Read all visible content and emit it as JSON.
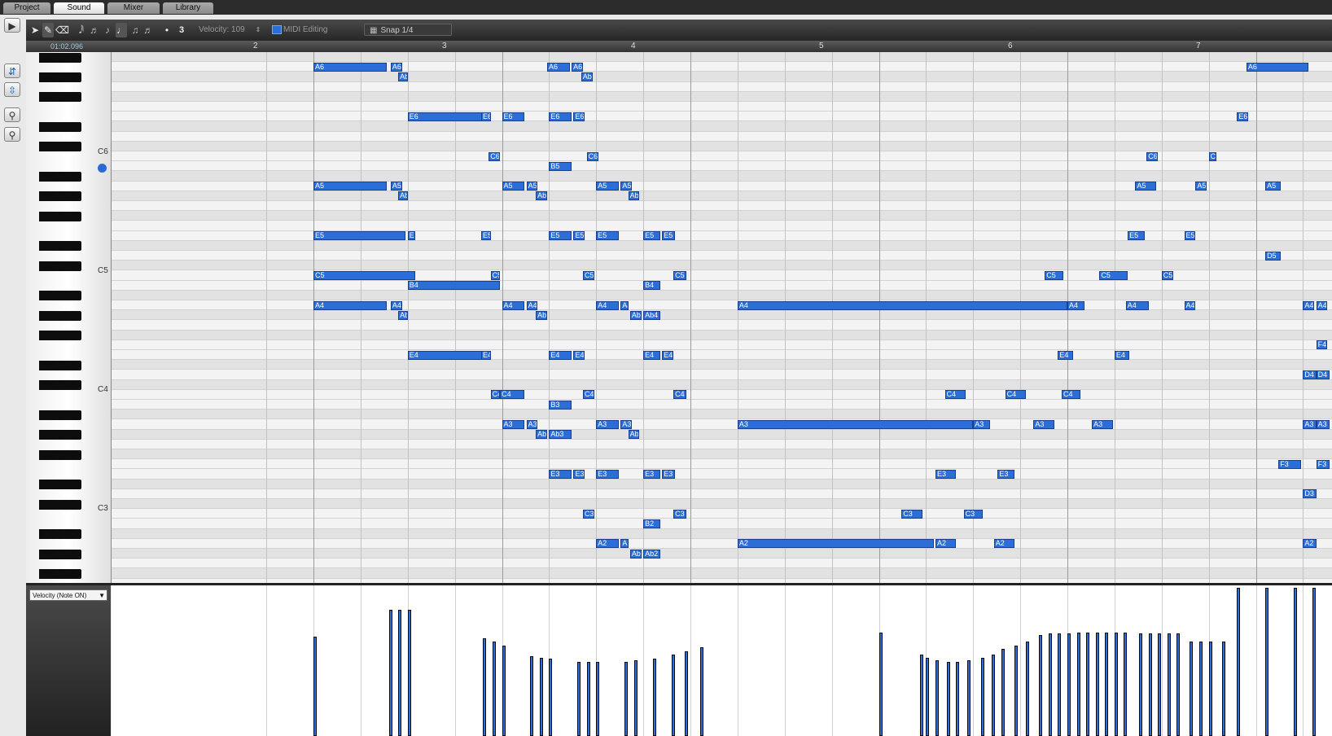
{
  "tabs": [
    {
      "label": "Project",
      "active": false
    },
    {
      "label": "Sound",
      "active": true
    },
    {
      "label": "Mixer",
      "active": false
    },
    {
      "label": "Library",
      "active": false
    }
  ],
  "toolbar": {
    "tools": [
      "pointer-tool-icon",
      "pencil-tool-icon",
      "eraser-tool-icon",
      "note-32nd-icon",
      "note-16th-icon",
      "note-8th-icon",
      "note-quarter-icon",
      "note-half-icon",
      "note-whole-icon",
      "dot-icon"
    ],
    "triplet_value": "3",
    "velocity_label": "Velocity: 109",
    "midi_editing_label": "MIDI Editing",
    "snap_label": "Snap 1/4"
  },
  "ruler": {
    "position": "01:02.096",
    "bars": [
      "2",
      "3",
      "4",
      "5",
      "6",
      "7"
    ]
  },
  "keyboard": {
    "c_labels": [
      "C6",
      "C5",
      "C4",
      "C3"
    ]
  },
  "accent_color": "#2c6ed8",
  "notes": [
    {
      "pitch": "A6",
      "start": 1.0,
      "len": 0.39
    },
    {
      "pitch": "A6",
      "start": 1.41,
      "len": 0.06
    },
    {
      "pitch": "Ab6",
      "start": 1.45,
      "len": 0.05
    },
    {
      "pitch": "A6",
      "start": 2.24,
      "len": 0.12
    },
    {
      "pitch": "A6",
      "start": 2.37,
      "len": 0.06
    },
    {
      "pitch": "Ab6",
      "start": 2.42,
      "len": 0.06
    },
    {
      "pitch": "A6",
      "start": 5.95,
      "len": 0.33
    },
    {
      "pitch": "E6",
      "start": 1.5,
      "len": 0.4
    },
    {
      "pitch": "E6",
      "start": 1.89,
      "len": 0.05
    },
    {
      "pitch": "E6",
      "start": 2.0,
      "len": 0.12
    },
    {
      "pitch": "E6",
      "start": 2.25,
      "len": 0.12
    },
    {
      "pitch": "E6",
      "start": 2.38,
      "len": 0.06
    },
    {
      "pitch": "E6",
      "start": 5.9,
      "len": 0.06
    },
    {
      "pitch": "C6",
      "start": 1.93,
      "len": 0.06
    },
    {
      "pitch": "C6",
      "start": 2.45,
      "len": 0.06
    },
    {
      "pitch": "C6",
      "start": 5.42,
      "len": 0.06
    },
    {
      "pitch": "C6",
      "start": 5.75,
      "len": 0.04
    },
    {
      "pitch": "B5",
      "start": 2.25,
      "len": 0.12
    },
    {
      "pitch": "A5",
      "start": 1.0,
      "len": 0.39
    },
    {
      "pitch": "A5",
      "start": 1.41,
      "len": 0.06
    },
    {
      "pitch": "Ab5",
      "start": 1.45,
      "len": 0.05
    },
    {
      "pitch": "A5",
      "start": 2.0,
      "len": 0.12
    },
    {
      "pitch": "A5",
      "start": 2.13,
      "len": 0.06
    },
    {
      "pitch": "Ab5",
      "start": 2.18,
      "len": 0.06
    },
    {
      "pitch": "A5",
      "start": 2.5,
      "len": 0.12
    },
    {
      "pitch": "A5",
      "start": 2.63,
      "len": 0.06
    },
    {
      "pitch": "Ab5",
      "start": 2.67,
      "len": 0.06
    },
    {
      "pitch": "A5",
      "start": 5.36,
      "len": 0.11
    },
    {
      "pitch": "A5",
      "start": 5.68,
      "len": 0.06
    },
    {
      "pitch": "A5",
      "start": 6.05,
      "len": 0.08
    },
    {
      "pitch": "E5",
      "start": 1.0,
      "len": 0.49
    },
    {
      "pitch": "E5",
      "start": 1.5,
      "len": 0.04
    },
    {
      "pitch": "E5",
      "start": 1.89,
      "len": 0.05
    },
    {
      "pitch": "E5",
      "start": 2.25,
      "len": 0.12
    },
    {
      "pitch": "E5",
      "start": 2.38,
      "len": 0.06
    },
    {
      "pitch": "E5",
      "start": 2.5,
      "len": 0.12
    },
    {
      "pitch": "E5",
      "start": 2.75,
      "len": 0.09
    },
    {
      "pitch": "E5",
      "start": 2.85,
      "len": 0.07
    },
    {
      "pitch": "E5",
      "start": 5.32,
      "len": 0.09
    },
    {
      "pitch": "E5",
      "start": 5.62,
      "len": 0.06
    },
    {
      "pitch": "D5",
      "start": 6.05,
      "len": 0.08
    },
    {
      "pitch": "C5",
      "start": 1.0,
      "len": 0.54
    },
    {
      "pitch": "C5",
      "start": 1.94,
      "len": 0.05
    },
    {
      "pitch": "C5",
      "start": 2.43,
      "len": 0.06
    },
    {
      "pitch": "C5",
      "start": 2.91,
      "len": 0.07
    },
    {
      "pitch": "C5",
      "start": 4.88,
      "len": 0.1
    },
    {
      "pitch": "C5",
      "start": 5.17,
      "len": 0.15
    },
    {
      "pitch": "C5",
      "start": 5.5,
      "len": 0.06
    },
    {
      "pitch": "B4",
      "start": 1.5,
      "len": 0.49
    },
    {
      "pitch": "B4",
      "start": 2.75,
      "len": 0.09
    },
    {
      "pitch": "A4",
      "start": 1.0,
      "len": 0.39
    },
    {
      "pitch": "A4",
      "start": 1.41,
      "len": 0.06
    },
    {
      "pitch": "Ab4",
      "start": 1.45,
      "len": 0.05
    },
    {
      "pitch": "A4",
      "start": 2.0,
      "len": 0.12
    },
    {
      "pitch": "A4",
      "start": 2.13,
      "len": 0.06
    },
    {
      "pitch": "Ab4",
      "start": 2.18,
      "len": 0.06
    },
    {
      "pitch": "A4",
      "start": 2.5,
      "len": 0.12
    },
    {
      "pitch": "A4",
      "start": 2.63,
      "len": 0.04
    },
    {
      "pitch": "Ab4",
      "start": 2.68,
      "len": 0.06
    },
    {
      "pitch": "Ab4",
      "start": 2.75,
      "len": 0.09
    },
    {
      "pitch": "A4",
      "start": 3.25,
      "len": 1.75
    },
    {
      "pitch": "A4",
      "start": 5.0,
      "len": 0.09
    },
    {
      "pitch": "A4",
      "start": 5.31,
      "len": 0.12
    },
    {
      "pitch": "A4",
      "start": 5.62,
      "len": 0.06
    },
    {
      "pitch": "A4",
      "start": 6.25,
      "len": 0.06
    },
    {
      "pitch": "A4",
      "start": 6.32,
      "len": 0.06
    },
    {
      "pitch": "F4",
      "start": 6.32,
      "len": 0.06
    },
    {
      "pitch": "E4",
      "start": 1.5,
      "len": 0.4
    },
    {
      "pitch": "E4",
      "start": 1.89,
      "len": 0.05
    },
    {
      "pitch": "E4",
      "start": 2.25,
      "len": 0.12
    },
    {
      "pitch": "E4",
      "start": 2.38,
      "len": 0.06
    },
    {
      "pitch": "E4",
      "start": 2.75,
      "len": 0.09
    },
    {
      "pitch": "E4",
      "start": 2.85,
      "len": 0.06
    },
    {
      "pitch": "E4",
      "start": 4.95,
      "len": 0.08
    },
    {
      "pitch": "E4",
      "start": 5.25,
      "len": 0.08
    },
    {
      "pitch": "D4",
      "start": 6.25,
      "len": 0.07
    },
    {
      "pitch": "D4",
      "start": 6.32,
      "len": 0.07
    },
    {
      "pitch": "C4",
      "start": 1.94,
      "len": 0.05
    },
    {
      "pitch": "C4",
      "start": 1.99,
      "len": 0.13
    },
    {
      "pitch": "C4",
      "start": 2.43,
      "len": 0.06
    },
    {
      "pitch": "C4",
      "start": 2.91,
      "len": 0.07
    },
    {
      "pitch": "C4",
      "start": 4.35,
      "len": 0.11
    },
    {
      "pitch": "C4",
      "start": 4.67,
      "len": 0.11
    },
    {
      "pitch": "C4",
      "start": 4.97,
      "len": 0.1
    },
    {
      "pitch": "B3",
      "start": 2.25,
      "len": 0.12
    },
    {
      "pitch": "A3",
      "start": 2.0,
      "len": 0.12
    },
    {
      "pitch": "A3",
      "start": 2.13,
      "len": 0.06
    },
    {
      "pitch": "Ab3",
      "start": 2.18,
      "len": 0.06
    },
    {
      "pitch": "Ab3",
      "start": 2.25,
      "len": 0.12
    },
    {
      "pitch": "A3",
      "start": 2.5,
      "len": 0.12
    },
    {
      "pitch": "A3",
      "start": 2.63,
      "len": 0.06
    },
    {
      "pitch": "Ab3",
      "start": 2.67,
      "len": 0.06
    },
    {
      "pitch": "A3",
      "start": 3.25,
      "len": 1.25
    },
    {
      "pitch": "A3",
      "start": 4.5,
      "len": 0.09
    },
    {
      "pitch": "A3",
      "start": 4.82,
      "len": 0.11
    },
    {
      "pitch": "A3",
      "start": 5.13,
      "len": 0.11
    },
    {
      "pitch": "A3",
      "start": 6.25,
      "len": 0.07
    },
    {
      "pitch": "A3",
      "start": 6.32,
      "len": 0.07
    },
    {
      "pitch": "F3",
      "start": 6.12,
      "len": 0.12
    },
    {
      "pitch": "F3",
      "start": 6.32,
      "len": 0.07
    },
    {
      "pitch": "E3",
      "start": 2.25,
      "len": 0.12
    },
    {
      "pitch": "E3",
      "start": 2.38,
      "len": 0.06
    },
    {
      "pitch": "E3",
      "start": 2.5,
      "len": 0.12
    },
    {
      "pitch": "E3",
      "start": 2.75,
      "len": 0.09
    },
    {
      "pitch": "E3",
      "start": 2.85,
      "len": 0.07
    },
    {
      "pitch": "E3",
      "start": 4.3,
      "len": 0.11
    },
    {
      "pitch": "E3",
      "start": 4.63,
      "len": 0.09
    },
    {
      "pitch": "D3",
      "start": 6.25,
      "len": 0.07
    },
    {
      "pitch": "C3",
      "start": 2.43,
      "len": 0.06
    },
    {
      "pitch": "C3",
      "start": 2.91,
      "len": 0.07
    },
    {
      "pitch": "C3",
      "start": 4.12,
      "len": 0.11
    },
    {
      "pitch": "C3",
      "start": 4.45,
      "len": 0.1
    },
    {
      "pitch": "B2",
      "start": 2.75,
      "len": 0.09
    },
    {
      "pitch": "A2",
      "start": 2.5,
      "len": 0.12
    },
    {
      "pitch": "A2",
      "start": 2.63,
      "len": 0.04
    },
    {
      "pitch": "Ab2",
      "start": 2.68,
      "len": 0.06
    },
    {
      "pitch": "Ab2",
      "start": 2.75,
      "len": 0.09
    },
    {
      "pitch": "A2",
      "start": 3.25,
      "len": 1.04
    },
    {
      "pitch": "A2",
      "start": 4.3,
      "len": 0.11
    },
    {
      "pitch": "A2",
      "start": 4.61,
      "len": 0.11
    },
    {
      "pitch": "A2",
      "start": 6.25,
      "len": 0.07
    }
  ],
  "velocity_lane": {
    "dropdown_label": "Velocity (Note ON)",
    "values": [
      {
        "t": 1.0,
        "v": 0.67
      },
      {
        "t": 1.4,
        "v": 0.85
      },
      {
        "t": 1.45,
        "v": 0.85
      },
      {
        "t": 1.5,
        "v": 0.85
      },
      {
        "t": 1.9,
        "v": 0.66
      },
      {
        "t": 1.95,
        "v": 0.64
      },
      {
        "t": 2.0,
        "v": 0.61
      },
      {
        "t": 2.15,
        "v": 0.54
      },
      {
        "t": 2.2,
        "v": 0.53
      },
      {
        "t": 2.25,
        "v": 0.52
      },
      {
        "t": 2.4,
        "v": 0.5
      },
      {
        "t": 2.45,
        "v": 0.5
      },
      {
        "t": 2.5,
        "v": 0.5
      },
      {
        "t": 2.65,
        "v": 0.5
      },
      {
        "t": 2.7,
        "v": 0.51
      },
      {
        "t": 2.8,
        "v": 0.52
      },
      {
        "t": 2.9,
        "v": 0.55
      },
      {
        "t": 2.97,
        "v": 0.57
      },
      {
        "t": 3.05,
        "v": 0.6
      },
      {
        "t": 4.0,
        "v": 0.7
      },
      {
        "t": 4.22,
        "v": 0.55
      },
      {
        "t": 4.25,
        "v": 0.53
      },
      {
        "t": 4.3,
        "v": 0.51
      },
      {
        "t": 4.36,
        "v": 0.5
      },
      {
        "t": 4.41,
        "v": 0.5
      },
      {
        "t": 4.47,
        "v": 0.51
      },
      {
        "t": 4.54,
        "v": 0.53
      },
      {
        "t": 4.6,
        "v": 0.55
      },
      {
        "t": 4.65,
        "v": 0.59
      },
      {
        "t": 4.72,
        "v": 0.61
      },
      {
        "t": 4.78,
        "v": 0.64
      },
      {
        "t": 4.85,
        "v": 0.68
      },
      {
        "t": 4.9,
        "v": 0.69
      },
      {
        "t": 4.95,
        "v": 0.69
      },
      {
        "t": 5.0,
        "v": 0.69
      },
      {
        "t": 5.05,
        "v": 0.7
      },
      {
        "t": 5.1,
        "v": 0.7
      },
      {
        "t": 5.15,
        "v": 0.7
      },
      {
        "t": 5.2,
        "v": 0.7
      },
      {
        "t": 5.25,
        "v": 0.7
      },
      {
        "t": 5.3,
        "v": 0.7
      },
      {
        "t": 5.38,
        "v": 0.69
      },
      {
        "t": 5.43,
        "v": 0.69
      },
      {
        "t": 5.48,
        "v": 0.69
      },
      {
        "t": 5.53,
        "v": 0.69
      },
      {
        "t": 5.58,
        "v": 0.69
      },
      {
        "t": 5.65,
        "v": 0.64
      },
      {
        "t": 5.7,
        "v": 0.64
      },
      {
        "t": 5.75,
        "v": 0.64
      },
      {
        "t": 5.82,
        "v": 0.64
      },
      {
        "t": 5.9,
        "v": 1.0
      },
      {
        "t": 6.05,
        "v": 1.0
      },
      {
        "t": 6.2,
        "v": 1.0
      },
      {
        "t": 6.3,
        "v": 1.0
      }
    ]
  }
}
